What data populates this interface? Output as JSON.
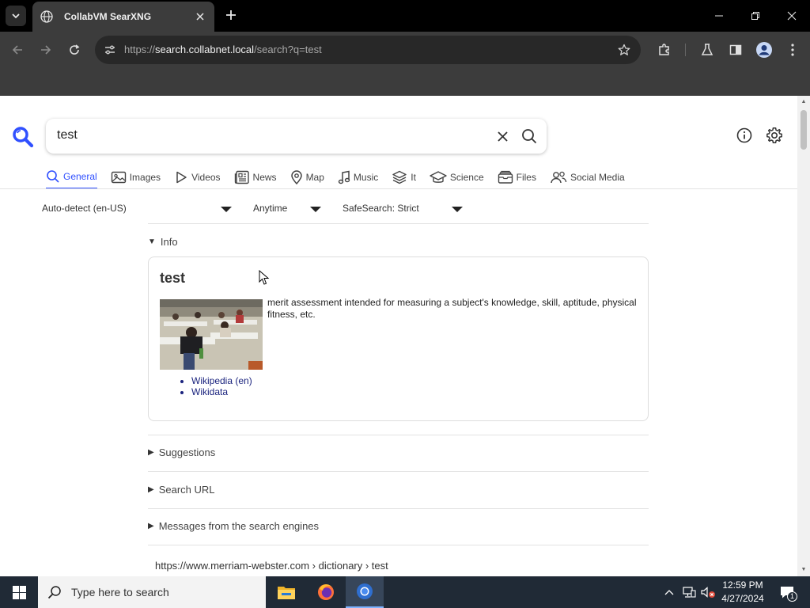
{
  "browser": {
    "tab_title": "CollabVM SearXNG",
    "url_scheme": "https://",
    "url_host": "search.collabnet.local",
    "url_path": "/search?q=test"
  },
  "search": {
    "query": "test"
  },
  "categories": [
    {
      "label": "General",
      "icon": "search-icon",
      "active": true
    },
    {
      "label": "Images",
      "icon": "image-icon"
    },
    {
      "label": "Videos",
      "icon": "play-icon"
    },
    {
      "label": "News",
      "icon": "newspaper-icon"
    },
    {
      "label": "Map",
      "icon": "map-pin-icon"
    },
    {
      "label": "Music",
      "icon": "music-note-icon"
    },
    {
      "label": "It",
      "icon": "layers-icon"
    },
    {
      "label": "Science",
      "icon": "graduation-cap-icon"
    },
    {
      "label": "Files",
      "icon": "files-icon"
    },
    {
      "label": "Social Media",
      "icon": "people-icon"
    }
  ],
  "filters": {
    "language": "Auto-detect (en-US)",
    "time": "Anytime",
    "safesearch": "SafeSearch: Strict"
  },
  "infobox": {
    "section_label": "Info",
    "title": "test",
    "description": "merit assessment intended for measuring a subject's knowledge, skill, aptitude, physical fitness, etc.",
    "links": [
      "Wikipedia (en)",
      "Wikidata"
    ]
  },
  "sections": {
    "suggestions": "Suggestions",
    "search_url": "Search URL",
    "messages": "Messages from the search engines"
  },
  "first_result": {
    "url": "https://www.merriam-webster.com",
    "breadcrumb": "› dictionary › test"
  },
  "taskbar": {
    "search_placeholder": "Type here to search",
    "time": "12:59 PM",
    "date": "4/27/2024",
    "notification_count": "1"
  },
  "colors": {
    "accent": "#3050ff",
    "link": "#1a237e",
    "chrome_dark": "#3c3c3c",
    "taskbar": "#202a36"
  }
}
